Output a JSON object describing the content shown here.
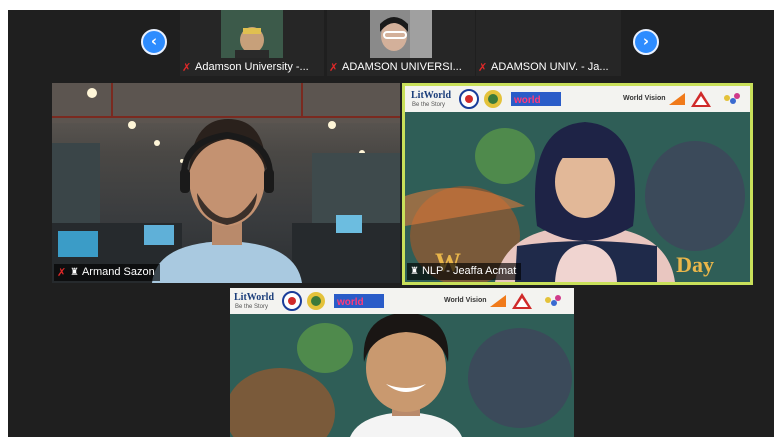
{
  "filmstrip": {
    "prev_arrow": "‹",
    "next_arrow": "›",
    "thumbnails": [
      {
        "label": "Adamson University -..."
      },
      {
        "label": "ADAMSON UNIVERSI..."
      },
      {
        "label": "ADAMSON UNIV. - Ja..."
      }
    ]
  },
  "tiles": {
    "armand": {
      "name": "Armand Sazon"
    },
    "jeaffa": {
      "name": "NLP - Jeaffa Acmat",
      "background_text": "Day"
    },
    "third": {}
  },
  "banner": {
    "logo_main": "LitWorld",
    "logo_sub": "Be the Story",
    "partner": "World Vision"
  },
  "colors": {
    "accent": "#2d8cff",
    "active_speaker_border": "#c9e05a",
    "muted_mic": "#e02828"
  },
  "icons": {
    "muted": "muted-mic-icon",
    "host": "host-icon"
  }
}
